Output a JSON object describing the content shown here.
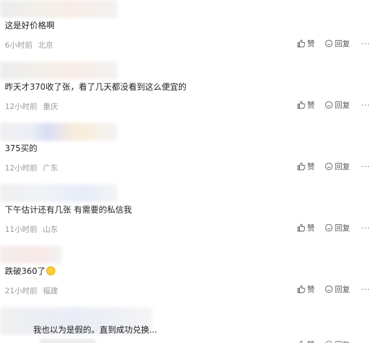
{
  "comments": [
    {
      "content": "这是好价格啊",
      "time": "6小时前",
      "location": "北京"
    },
    {
      "content": "昨天才370收了张，看了几天都没看到这么便宜的",
      "time": "12小时前",
      "location": "重庆"
    },
    {
      "content": "375买的",
      "time": "12小时前",
      "location": "广东"
    },
    {
      "content": "下午估计还有几张 有需要的私信我",
      "time": "11小时前",
      "location": "山东"
    },
    {
      "content": "跌破360了",
      "time": "21小时前",
      "location": "福建"
    }
  ],
  "last_comment": {
    "content": "我也以为是假的。直到成功兑换..."
  },
  "actions": {
    "like_label": "赞",
    "reply_label": "回复",
    "more_label": "···"
  },
  "icons": {
    "like": "thumbs-up-icon",
    "reply": "reply-bubble-icon",
    "more": "more-dots-icon",
    "emoji": "smile-emoji-icon"
  },
  "colors": {
    "text": "#222222",
    "meta": "#9a9a9a",
    "action": "#555555"
  }
}
